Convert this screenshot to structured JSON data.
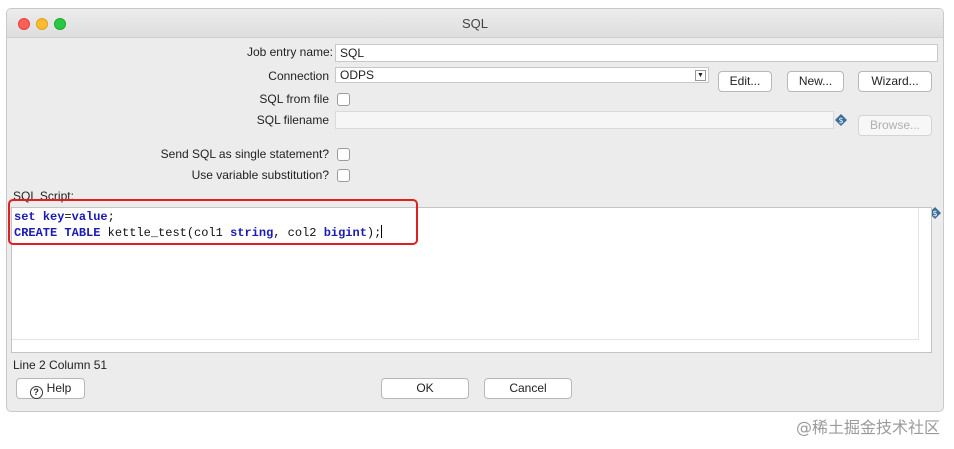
{
  "window": {
    "title": "SQL"
  },
  "form": {
    "job_entry_name_label": "Job entry name:",
    "job_entry_name_value": "SQL",
    "connection_label": "Connection",
    "connection_value": "ODPS",
    "edit_label": "Edit...",
    "new_label": "New...",
    "wizard_label": "Wizard...",
    "sql_from_file_label": "SQL from file",
    "sql_filename_label": "SQL filename",
    "sql_filename_value": "",
    "browse_label": "Browse...",
    "send_single_label": "Send SQL as single statement?",
    "use_variable_label": "Use variable substitution?",
    "sql_script_label": "SQL Script:"
  },
  "script": {
    "line1": {
      "kw1": "set",
      "kw2": "key",
      "eq": "=",
      "kw3": "value",
      "end": ";"
    },
    "line2": {
      "kw1": "CREATE",
      "kw2": "TABLE",
      "name": "kettle_test(col1",
      "kw3": "string",
      "mid": ", col2",
      "kw4": "bigint",
      "end": ");"
    }
  },
  "status": {
    "position": "Line 2 Column 51"
  },
  "footer": {
    "help_label": "Help",
    "ok_label": "OK",
    "cancel_label": "Cancel"
  },
  "watermark": "@稀土掘金技术社区",
  "colors": {
    "highlight": "#e02020",
    "keyword": "#1a1ab4"
  },
  "icons": [
    "variable-icon",
    "help-icon",
    "dropdown-arrow-icon"
  ]
}
